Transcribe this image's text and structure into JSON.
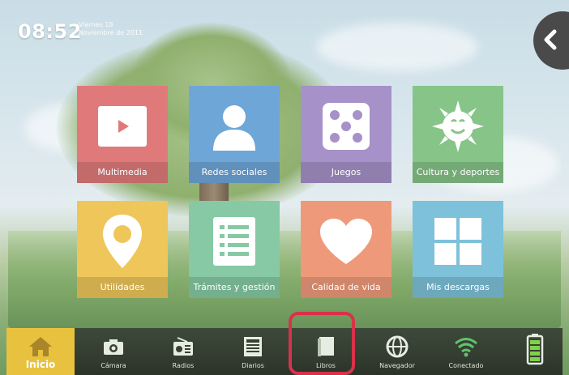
{
  "status": {
    "time": "08:52",
    "date_line1": "Viernes 18",
    "date_line2": "Noviembre de 2011"
  },
  "tiles": [
    {
      "label": "Multimedia",
      "icon": "play-icon",
      "color": "#e07a7a"
    },
    {
      "label": "Redes sociales",
      "icon": "person-icon",
      "color": "#6fa6d8"
    },
    {
      "label": "Juegos",
      "icon": "dice-icon",
      "color": "#a691c9"
    },
    {
      "label": "Cultura y deportes",
      "icon": "sun-mask-icon",
      "color": "#86c488"
    },
    {
      "label": "Utilidades",
      "icon": "map-pin-icon",
      "color": "#eec65a"
    },
    {
      "label": "Trámites y gestión",
      "icon": "document-list-icon",
      "color": "#86c9a4"
    },
    {
      "label": "Calidad de vida",
      "icon": "heart-icon",
      "color": "#ee9a7a"
    },
    {
      "label": "Mis descargas",
      "icon": "grid-icon",
      "color": "#7ec1da"
    }
  ],
  "taskbar": {
    "items": [
      {
        "label": "Inicio",
        "icon": "home-icon"
      },
      {
        "label": "Cámara",
        "icon": "camera-icon"
      },
      {
        "label": "Radios",
        "icon": "radio-icon"
      },
      {
        "label": "Diarios",
        "icon": "newspaper-icon"
      },
      {
        "label": "Libros",
        "icon": "book-icon"
      },
      {
        "label": "Navegador",
        "icon": "globe-icon"
      },
      {
        "label": "Conectado",
        "icon": "wifi-icon"
      },
      {
        "label": "",
        "icon": "battery-icon"
      }
    ],
    "home_color": "#e8c23e",
    "highlight_color": "#d8324a"
  },
  "nav": {
    "back_icon": "chevron-left-icon"
  }
}
